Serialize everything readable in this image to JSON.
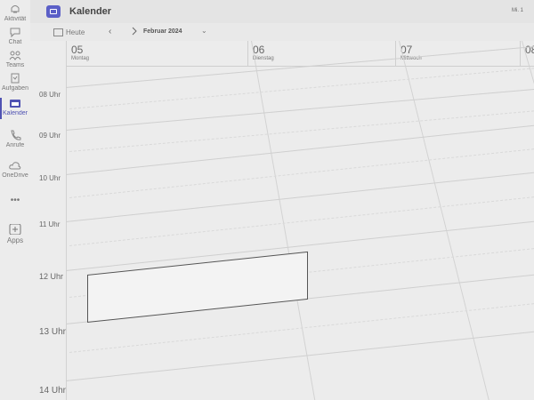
{
  "rail": {
    "items": [
      {
        "label": "Aktivität",
        "icon": "bell-icon"
      },
      {
        "label": "Chat",
        "icon": "chat-icon"
      },
      {
        "label": "Teams",
        "icon": "teams-icon"
      },
      {
        "label": "Aufgaben",
        "icon": "tasks-icon"
      },
      {
        "label": "Kalender",
        "icon": "calendar-icon",
        "active": true
      },
      {
        "label": "Anrufe",
        "icon": "phone-icon"
      },
      {
        "label": "OneDrive",
        "icon": "cloud-icon"
      },
      {
        "label": "•••",
        "icon": "more-icon"
      },
      {
        "label": "Apps",
        "icon": "add-apps-icon"
      }
    ]
  },
  "header": {
    "title": "Kalender",
    "right_text": "Mi. 1"
  },
  "toolbar": {
    "today_label": "Heute",
    "prev_glyph": "‹",
    "month_label": "Februar 2024",
    "chevron_glyph": "⌄"
  },
  "days": [
    {
      "num": "05",
      "name": "Montag"
    },
    {
      "num": "06",
      "name": "Dienstag"
    },
    {
      "num": "07",
      "name": "Mittwoch"
    },
    {
      "num": "08",
      "name": ""
    }
  ],
  "hours": [
    "08 Uhr",
    "09 Uhr",
    "10 Uhr",
    "11 Uhr",
    "12 Uhr",
    "13 Uhr",
    "14 Uhr"
  ],
  "colors": {
    "accent": "#4f52b2",
    "background": "#e9e9e9"
  }
}
